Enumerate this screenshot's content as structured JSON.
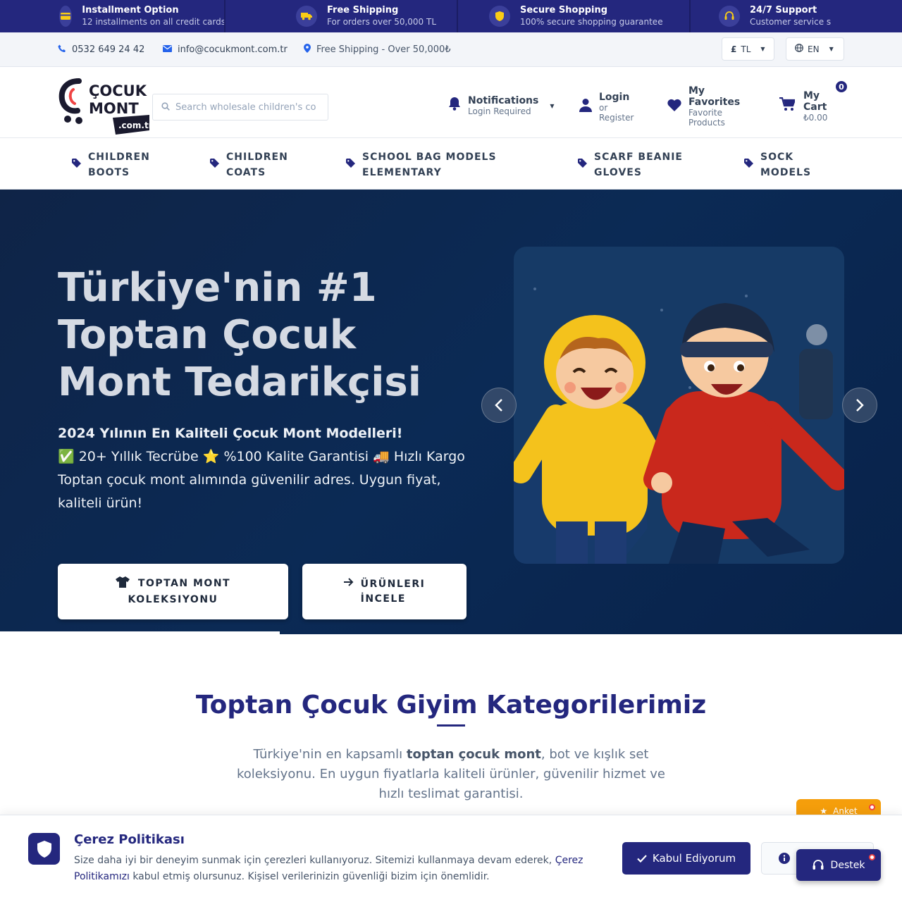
{
  "promo": [
    {
      "icon": "credit-card-icon",
      "title": "Installment Option",
      "sub": "12 installments on all credit cards"
    },
    {
      "icon": "truck-icon",
      "title": "Free Shipping",
      "sub": "For orders over 50,000 TL"
    },
    {
      "icon": "shield-icon",
      "title": "Secure Shopping",
      "sub": "100% secure shopping guarantee"
    },
    {
      "icon": "headset-icon",
      "title": "24/7 Support",
      "sub": "Customer service s"
    }
  ],
  "contact": {
    "phone": "0532 649 24 42",
    "email": "info@cocukmont.com.tr",
    "shipping": "Free Shipping - Over 50,000₺",
    "currency": "TL",
    "language": "EN"
  },
  "header": {
    "logo_text": "ÇOCUK MONT .com.tr",
    "search_placeholder": "Search wholesale children's co",
    "notifications_title": "Notifications",
    "notifications_sub": "Login Required",
    "login_title": "Login",
    "login_or": "or",
    "login_register": "Register",
    "favorites_title_1": "My",
    "favorites_title_2": "Favorites",
    "favorites_sub_1": "Favorite",
    "favorites_sub_2": "Products",
    "cart_title_1": "My",
    "cart_title_2": "Cart",
    "cart_total": "₺0.00",
    "cart_count": "0"
  },
  "nav": [
    {
      "l1": "CHILDREN",
      "l2": "BOOTS"
    },
    {
      "l1": "CHILDREN",
      "l2": "COATS"
    },
    {
      "l1": "SCHOOL BAG MODELS",
      "l2": "ELEMENTARY"
    },
    {
      "l1": "SCARF BEANIE",
      "l2": "GLOVES"
    },
    {
      "l1": "SOCK",
      "l2": "MODELS"
    }
  ],
  "hero": {
    "title_1": "Türkiye'nin #1",
    "title_2": "Toptan Çocuk",
    "title_3": "Mont Tedarikçisi",
    "subtitle_bold": "2024 Yılının En Kaliteli Çocuk Mont Modelleri!",
    "subtitle_1": "✅ 20+ Yıllık Tecrübe ⭐ %100 Kalite Garantisi 🚚 Hızlı Kargo",
    "subtitle_2": "Toptan çocuk mont alımında güvenilir adres. Uygun fiyat, kaliteli ürün!",
    "btn1_l1": "TOPTAN MONT",
    "btn1_l2": "KOLEKSIYONU",
    "btn2_l1": "ÜRÜNLERI",
    "btn2_l2": "İNCELE",
    "slide_progress": 0.31
  },
  "categories": {
    "title": "Toptan Çocuk Giyim Kategorilerimiz",
    "desc_pre": "Türkiye'nin en kapsamlı ",
    "desc_bold": "toptan çocuk mont",
    "desc_post": ", bot ve kışlık set koleksiyonu. En uygun fiyatlarla kaliteli ürünler, güvenilir hizmet ve hızlı teslimat garantisi."
  },
  "cookie": {
    "title": "Çerez Politikası",
    "text_pre": "Size daha iyi bir deneyim sunmak için çerezleri kullanıyoruz. Sitemizi kullanmaya devam ederek, ",
    "link": "Çerez Politikamızı",
    "text_post": " kabul etmiş olursunuz. Kişisel verilerinizin güvenliği bizim için önemlidir.",
    "accept": "Kabul Ediyorum"
  },
  "floating": {
    "survey": "Anket",
    "support": "Destek"
  },
  "colors": {
    "brand": "#24277e",
    "accent": "#facc15",
    "link": "#2563eb"
  }
}
